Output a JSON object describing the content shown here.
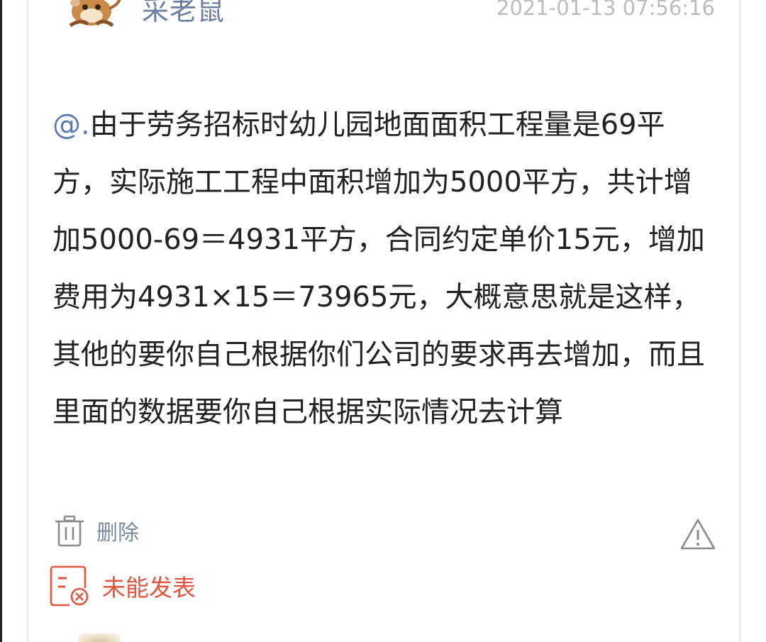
{
  "post": {
    "username": "采老鼠",
    "timestamp": "2021-01-13 07:56:16",
    "mention": "@.",
    "body": "由于劳务招标时幼儿园地面面积工程量是69平方，实际施工工程中面积增加为5000平方，共计增加5000-69＝4931平方，合同约定单价15元，增加费用为4931×15＝73965元，大概意思就是这样，其他的要你自己根据你们公司的要求再去增加，而且里面的数据要你自己根据实际情况去计算"
  },
  "actions": {
    "delete_label": "删除",
    "delete_icon": "trash-icon",
    "report_icon": "warning-triangle-icon"
  },
  "status": {
    "fail_label": "未能发表",
    "fail_icon": "post-failed-icon",
    "fail_color": "#e5533c"
  },
  "colors": {
    "username": "#6b7fa3",
    "timestamp": "#bdbdbd",
    "text": "#222222",
    "mention": "#5a7bb5"
  }
}
